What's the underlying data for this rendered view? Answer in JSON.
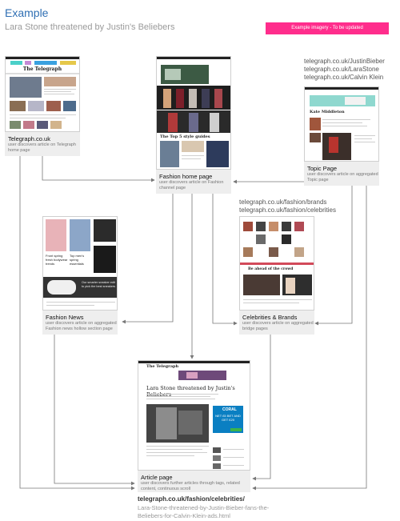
{
  "header": {
    "title": "Example",
    "subtitle": "Lara Stone threatened by Justin's Beliebers",
    "badge": "Example imagery - To be updated"
  },
  "nodes": {
    "telegraph": {
      "caption": "Telegraph.co.uk",
      "desc": "user discovers article on Telegraph home page"
    },
    "fashion_home": {
      "caption": "Fashion home page",
      "desc": "user discovers article on Fashion channel page"
    },
    "topic": {
      "caption": "Topic Page",
      "desc": "user discovers article on aggregated Topic page"
    },
    "fashion_news": {
      "caption": "Fashion News",
      "desc": "user discovers article on aggregated Fashion news hollow section page"
    },
    "celebs": {
      "caption": "Celebrities & Brands",
      "desc": "user discovers article on aggregated bridge pages"
    },
    "article": {
      "caption": "Article page",
      "desc": "user discovers further articles through tags, related content, continuous scroll"
    }
  },
  "urls": {
    "topic": [
      "telegraph.co.uk/JustinBieber",
      "telegraph.co.uk/LaraStone",
      "telegraph.co.uk/Calvin Klein"
    ],
    "celebs": [
      "telegraph.co.uk/fashion/brands",
      "telegraph.co.uk/fashion/celebrities"
    ],
    "article_path": "telegraph.co.uk/fashion/celebrities/",
    "article_slug": "Lara-Stone-threatened-by-Justin-Bieber-fans-the-Beliebers-for-Calvin-Klein-ads.html"
  },
  "thumb_text": {
    "telegraph_masthead": "The Telegraph",
    "fashion_section_title": "The Top 5 style guides",
    "topic_name": "Kate Middleton",
    "fashion_news_headline_1": "Front spring fresh bodywear trends",
    "fashion_news_headline_2": "Top men's spring essentials",
    "fashion_news_promo": "Our smarter sneaker edit to pick the best sneakers",
    "celebs_promo": "Be ahead of the crowd",
    "article_masthead": "The Telegraph",
    "article_headline": "Lara Stone threatened by Justin's Beliebers",
    "ad_brand": "CORAL",
    "ad_offer": "NET £5 BET AND GET £20"
  },
  "colors": {
    "title_blue": "#2f6fb3",
    "badge_pink": "#ff2d8c",
    "node_bg": "#eeeeee",
    "connector": "#777777"
  }
}
